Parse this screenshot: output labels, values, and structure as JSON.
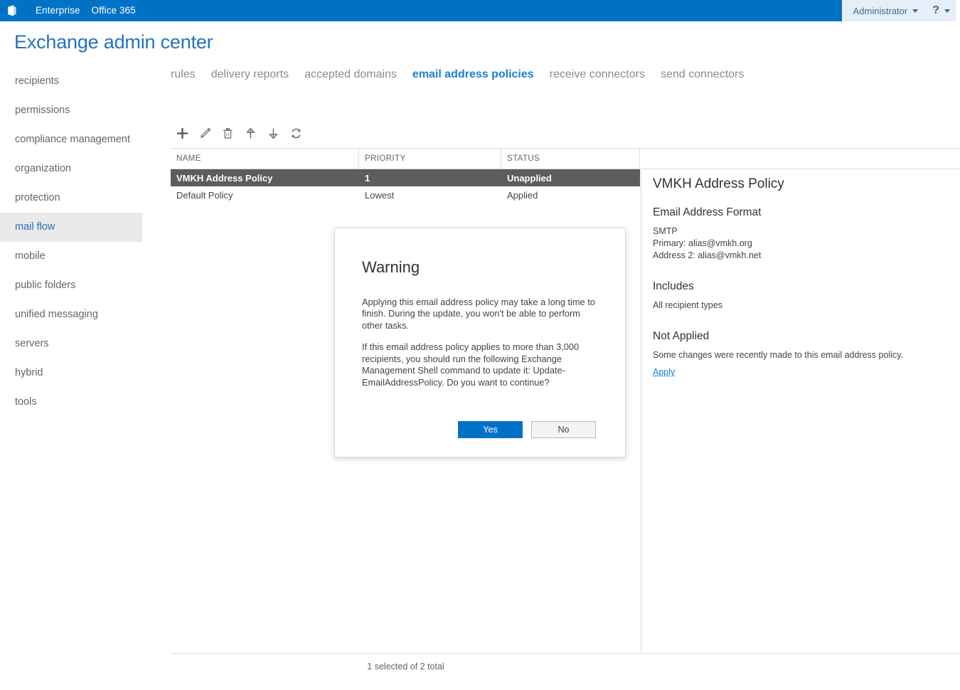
{
  "suite_bar": {
    "logo_icon": "office-logo-icon",
    "links": [
      "Enterprise",
      "Office 365"
    ],
    "user": "Administrator",
    "user_caret_icon": "chevron-down-icon",
    "help_icon": "question-mark-icon",
    "help_caret_icon": "chevron-down-icon",
    "accent_color": "#0072c6",
    "right_bg_color": "#e6eff7"
  },
  "page": {
    "title": "Exchange admin center",
    "title_color": "#2672ba"
  },
  "sidebar": {
    "items": [
      {
        "label": "recipients",
        "active": false
      },
      {
        "label": "permissions",
        "active": false
      },
      {
        "label": "compliance management",
        "active": false
      },
      {
        "label": "organization",
        "active": false
      },
      {
        "label": "protection",
        "active": false
      },
      {
        "label": "mail flow",
        "active": true
      },
      {
        "label": "mobile",
        "active": false
      },
      {
        "label": "public folders",
        "active": false
      },
      {
        "label": "unified messaging",
        "active": false
      },
      {
        "label": "servers",
        "active": false
      },
      {
        "label": "hybrid",
        "active": false
      },
      {
        "label": "tools",
        "active": false
      }
    ],
    "active_bg_color": "#eaeaea",
    "active_text_color": "#2672ba"
  },
  "tabs": [
    {
      "label": "rules",
      "active": false
    },
    {
      "label": "delivery reports",
      "active": false
    },
    {
      "label": "accepted domains",
      "active": false
    },
    {
      "label": "email address policies",
      "active": true
    },
    {
      "label": "receive connectors",
      "active": false
    },
    {
      "label": "send connectors",
      "active": false
    }
  ],
  "toolbar": {
    "buttons": [
      {
        "name": "add-icon",
        "title": "New"
      },
      {
        "name": "edit-pencil-icon",
        "title": "Edit"
      },
      {
        "name": "delete-trash-icon",
        "title": "Delete"
      },
      {
        "name": "move-up-arrow-icon",
        "title": "Move up"
      },
      {
        "name": "move-down-arrow-icon",
        "title": "Move down"
      },
      {
        "name": "refresh-icon",
        "title": "Refresh"
      }
    ]
  },
  "table": {
    "columns": [
      "NAME",
      "PRIORITY",
      "STATUS"
    ],
    "rows": [
      {
        "name": "VMKH Address Policy",
        "priority": "1",
        "status": "Unapplied",
        "selected": true
      },
      {
        "name": "Default Policy",
        "priority": "Lowest",
        "status": "Applied",
        "selected": false
      }
    ],
    "selected_row_bg": "#5d5d5d",
    "footer": "1 selected of 2 total"
  },
  "details": {
    "title": "VMKH Address Policy",
    "sections": [
      {
        "heading": "Email Address Format",
        "lines": [
          "SMTP",
          "Primary: alias@vmkh.org",
          "Address 2: alias@vmkh.net"
        ]
      },
      {
        "heading": "Includes",
        "lines": [
          "All recipient types"
        ]
      },
      {
        "heading": "Not Applied",
        "lines": [
          "Some changes were recently made to this email address policy."
        ]
      }
    ],
    "apply_link": "Apply",
    "link_color": "#1a80d4"
  },
  "dialog": {
    "title": "Warning",
    "paragraphs": [
      "Applying this email address policy may take a long time to finish. During the update, you won't be able to perform other tasks.",
      "If this email address policy applies to more than 3,000 recipients, you should run the following Exchange Management Shell command to update it: Update-EmailAddressPolicy. Do you want to continue?"
    ],
    "yes_label": "Yes",
    "no_label": "No",
    "primary_color": "#0072c6"
  }
}
